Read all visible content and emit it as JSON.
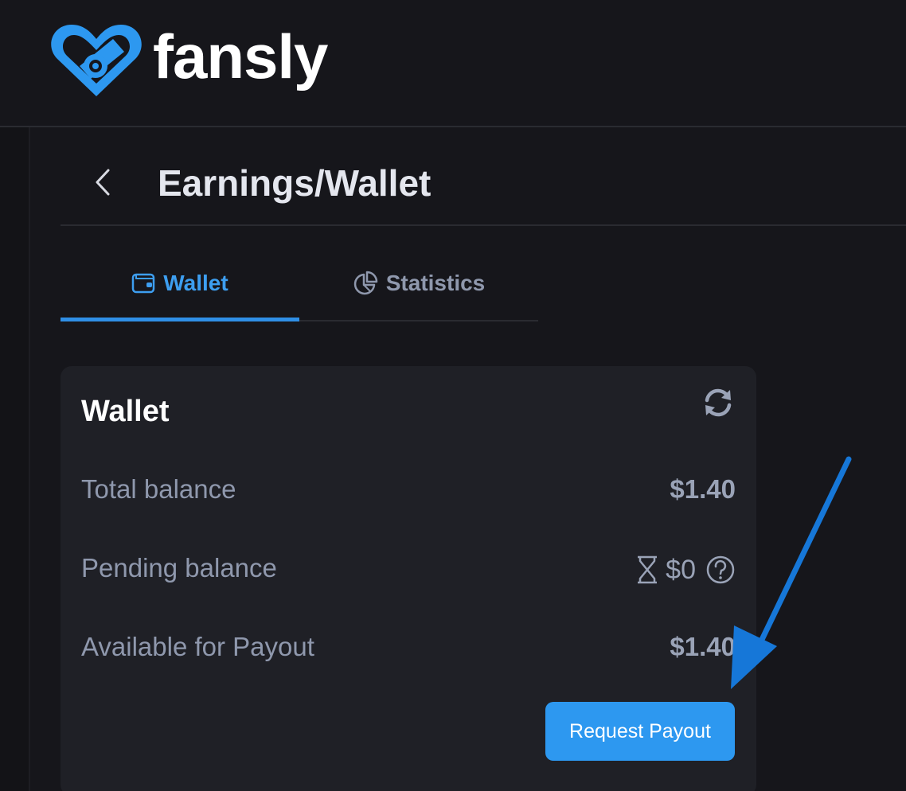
{
  "brand": {
    "name": "fansly",
    "accent_color": "#2d98f0"
  },
  "header": {
    "back_icon": "chevron-left-icon",
    "title": "Earnings/Wallet"
  },
  "tabs": [
    {
      "label": "Wallet",
      "icon": "wallet-icon",
      "active": true
    },
    {
      "label": "Statistics",
      "icon": "pie-chart-icon",
      "active": false
    }
  ],
  "wallet_card": {
    "title": "Wallet",
    "refresh_icon": "refresh-icon",
    "rows": [
      {
        "label": "Total balance",
        "value": "$1.40"
      },
      {
        "label": "Pending balance",
        "value": "$0",
        "icons": [
          "hourglass-icon",
          "dollar-icon",
          "question-icon"
        ]
      },
      {
        "label": "Available for Payout",
        "value": "$1.40"
      }
    ],
    "payout_button": "Request Payout"
  },
  "annotation": {
    "arrow_color": "#1677d8",
    "arrow_icon": "pointer-arrow-icon"
  }
}
